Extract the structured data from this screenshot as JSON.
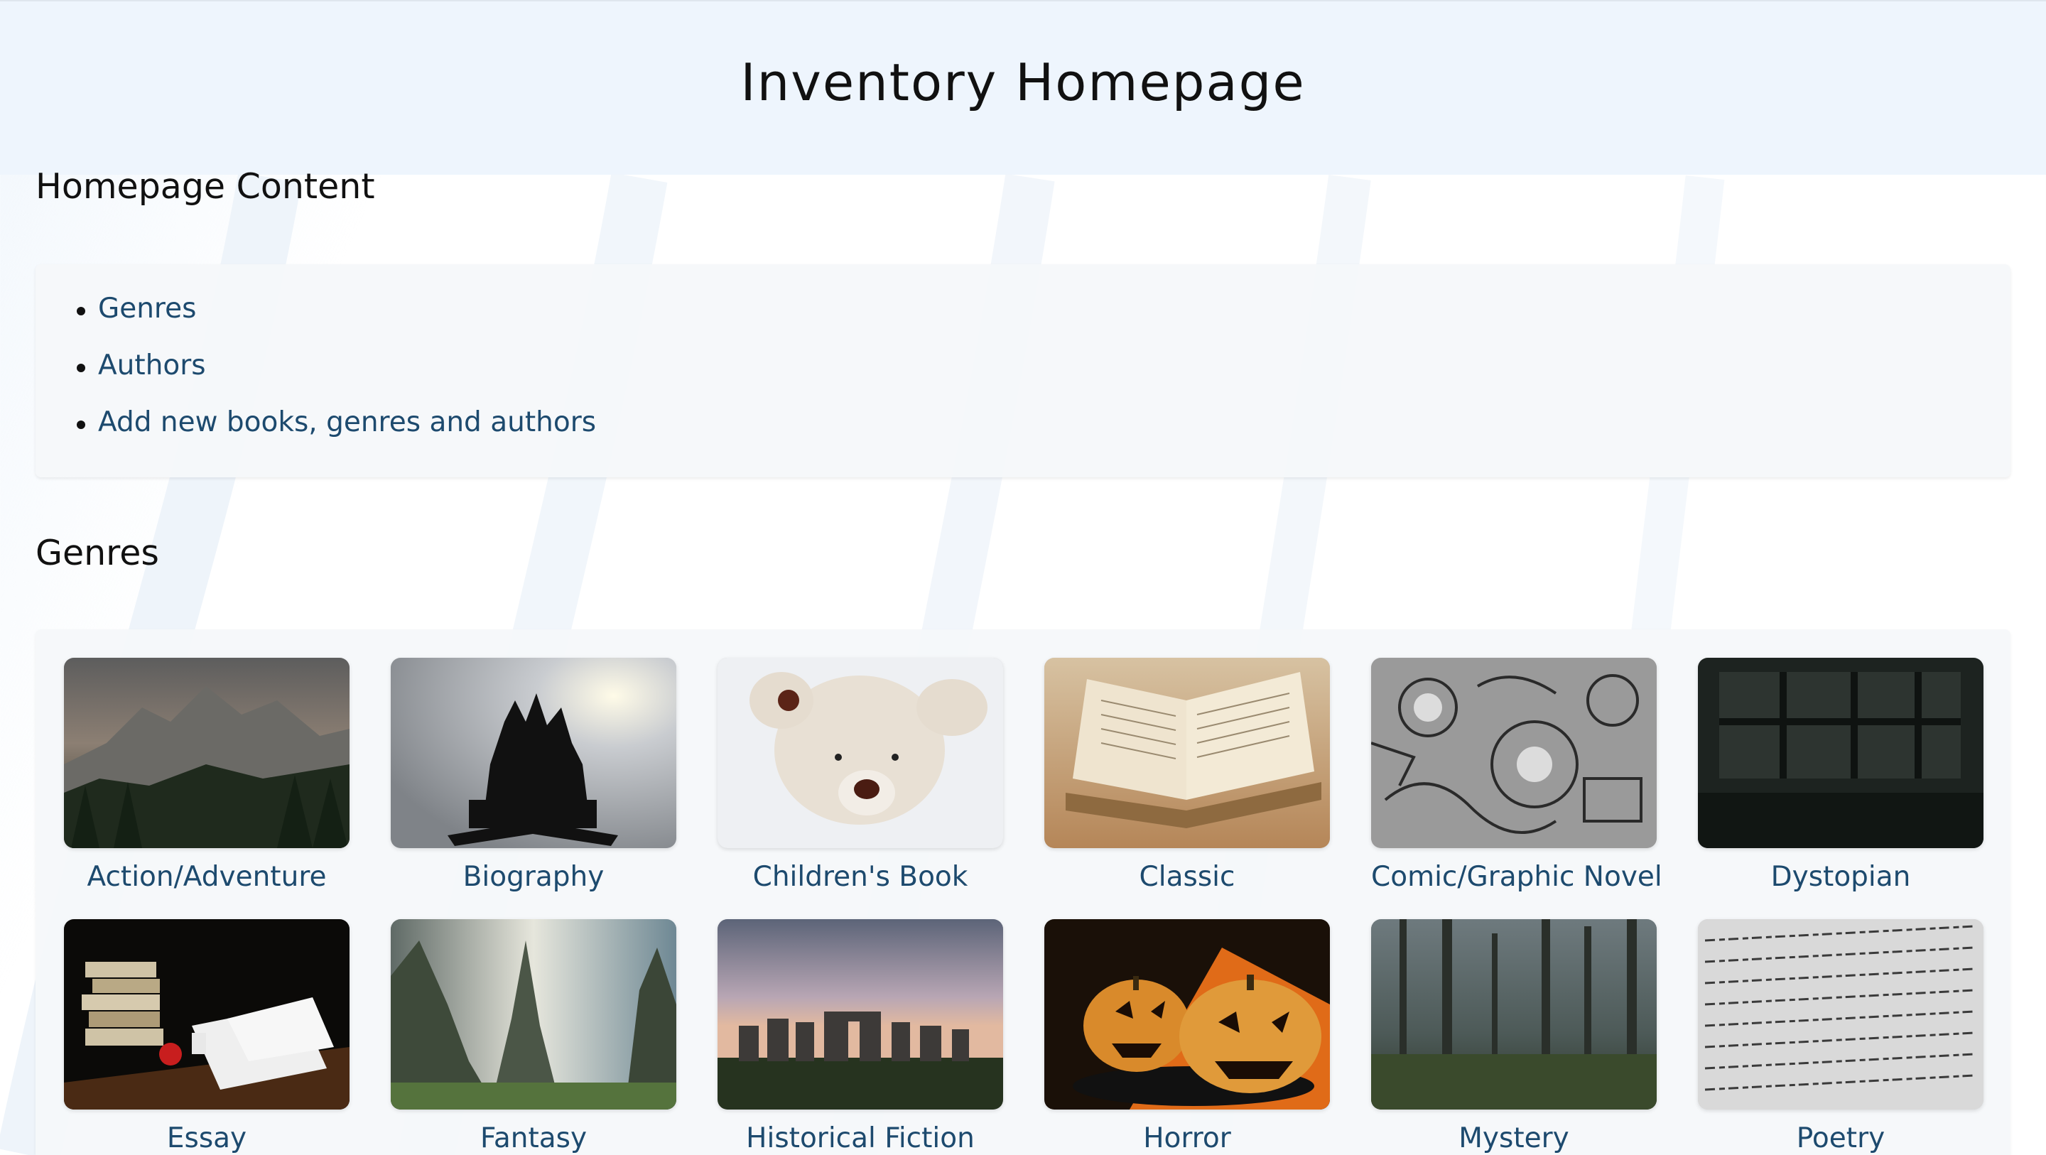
{
  "header": {
    "title": "Inventory Homepage"
  },
  "homepage_content": {
    "heading": "Homepage Content",
    "links": [
      {
        "label": "Genres"
      },
      {
        "label": "Authors"
      },
      {
        "label": "Add new books, genres and authors"
      }
    ]
  },
  "genres": {
    "heading": "Genres",
    "items": [
      {
        "label": "Action/Adventure",
        "image": "misty-mountain-forest"
      },
      {
        "label": "Biography",
        "image": "open-book-tree-silhouette"
      },
      {
        "label": "Children's Book",
        "image": "teddy-bear"
      },
      {
        "label": "Classic",
        "image": "old-open-book"
      },
      {
        "label": "Comic/Graphic Novel",
        "image": "doodle-drawing"
      },
      {
        "label": "Dystopian",
        "image": "ruined-building"
      },
      {
        "label": "Essay",
        "image": "desk-with-papers"
      },
      {
        "label": "Fantasy",
        "image": "fantasy-cliffs"
      },
      {
        "label": "Historical Fiction",
        "image": "stonehenge"
      },
      {
        "label": "Horror",
        "image": "jack-o-lanterns"
      },
      {
        "label": "Mystery",
        "image": "foggy-forest"
      },
      {
        "label": "Poetry",
        "image": "handwritten-page"
      }
    ]
  }
}
